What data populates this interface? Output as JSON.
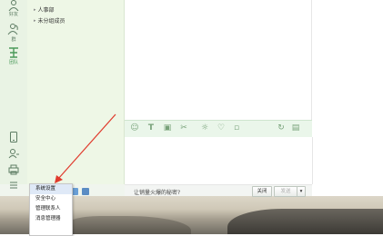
{
  "sidebar": {
    "items": [
      {
        "name": "friends",
        "label": "好友",
        "icon": "person-icon"
      },
      {
        "name": "groups",
        "label": "群",
        "icon": "group-icon"
      },
      {
        "name": "team",
        "label": "团队",
        "icon": "team-icon"
      }
    ],
    "bottom_icons": [
      "phone-icon",
      "contact-icon",
      "printer-icon",
      "menu-icon"
    ]
  },
  "contacts": {
    "groups": [
      {
        "label": "人事部"
      },
      {
        "label": "未分组成员"
      }
    ]
  },
  "chat": {
    "toolbar_icons": [
      "emoji-icon",
      "text-icon",
      "image-icon",
      "scissors-icon",
      "shake-icon",
      "heart-icon",
      "history-icon",
      "more-icon"
    ],
    "input_hint": "让销量火爆的秘密?",
    "close_label": "关闭",
    "send_label": "发送"
  },
  "menu": {
    "items": [
      {
        "label": "系统设置"
      },
      {
        "label": "安全中心"
      },
      {
        "label": "管理联系人"
      },
      {
        "label": "消息管理器"
      }
    ]
  },
  "colors": {
    "sidebar_bg": "#e9f3e4",
    "toolbar_bg": "#eaf6ea",
    "arrow": "#e03a2c"
  }
}
